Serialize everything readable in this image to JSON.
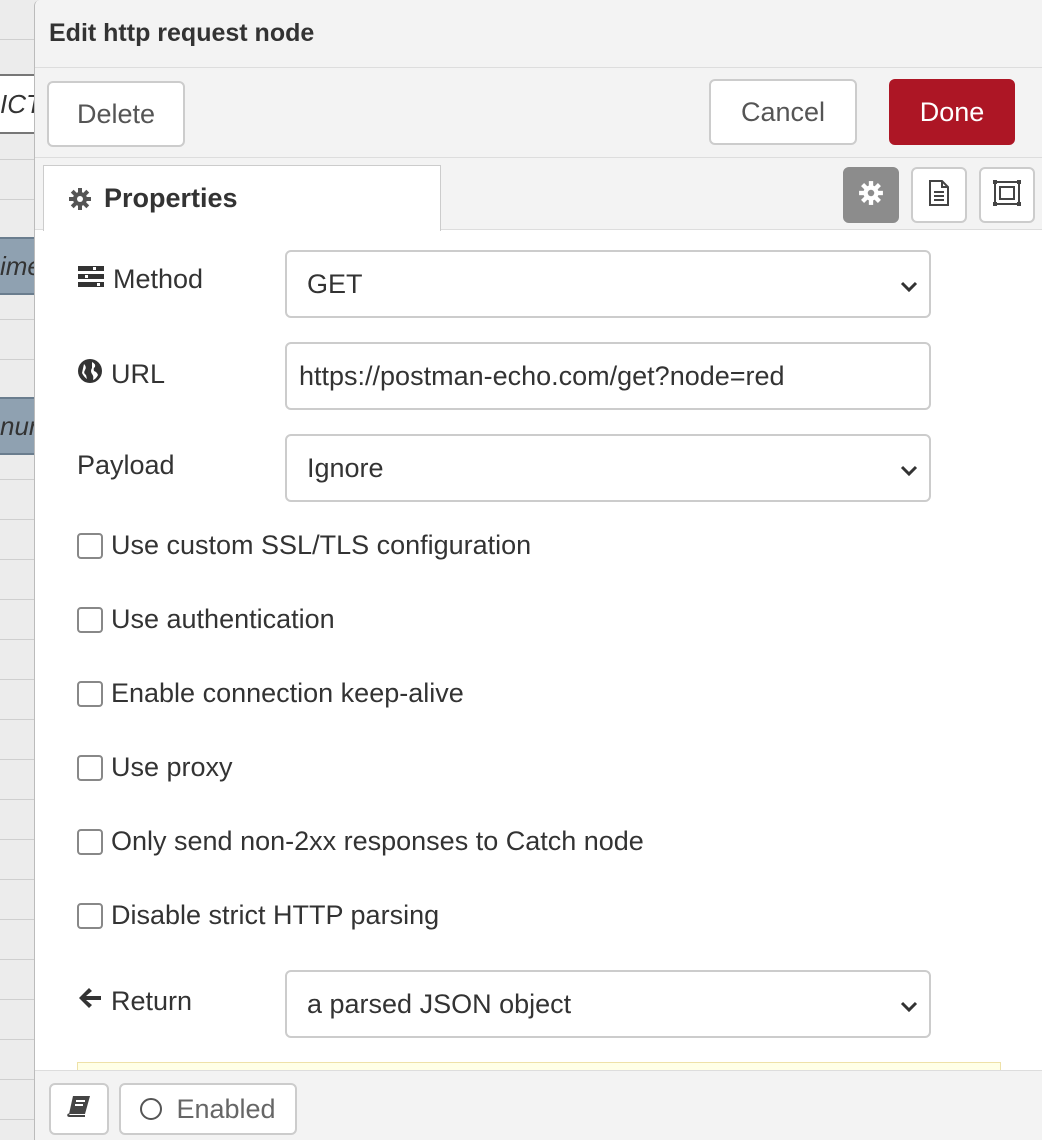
{
  "background": {
    "node_fragments": [
      "ICT",
      "ime",
      "nur"
    ]
  },
  "dialog": {
    "title": "Edit http request node",
    "buttons": {
      "delete": "Delete",
      "cancel": "Cancel",
      "done": "Done"
    },
    "tabs": [
      {
        "label": "Properties",
        "icon": "gear-icon",
        "active": true
      }
    ],
    "tool_icons": [
      "gear-icon",
      "document-icon",
      "frame-icon"
    ],
    "form": {
      "method": {
        "label": "Method",
        "icon": "tasks-icon",
        "value": "GET"
      },
      "url": {
        "label": "URL",
        "icon": "globe-icon",
        "value": "https://postman-echo.com/get?node=red"
      },
      "payload": {
        "label": "Payload",
        "value": "Ignore"
      },
      "checkboxes": [
        {
          "label": "Use custom SSL/TLS configuration",
          "checked": false
        },
        {
          "label": "Use authentication",
          "checked": false
        },
        {
          "label": "Enable connection keep-alive",
          "checked": false
        },
        {
          "label": "Use proxy",
          "checked": false
        },
        {
          "label": "Only send non-2xx responses to Catch node",
          "checked": false
        },
        {
          "label": "Disable strict HTTP parsing",
          "checked": false
        }
      ],
      "return": {
        "label": "Return",
        "icon": "arrow-left-icon",
        "value": "a parsed JSON object"
      }
    },
    "footer": {
      "enabled_label": "Enabled",
      "book_icon": "book-icon"
    }
  },
  "colors": {
    "done_button": "#ad1625",
    "active_tool": "#8c8c8c",
    "tip_box": "#ffffe6"
  }
}
